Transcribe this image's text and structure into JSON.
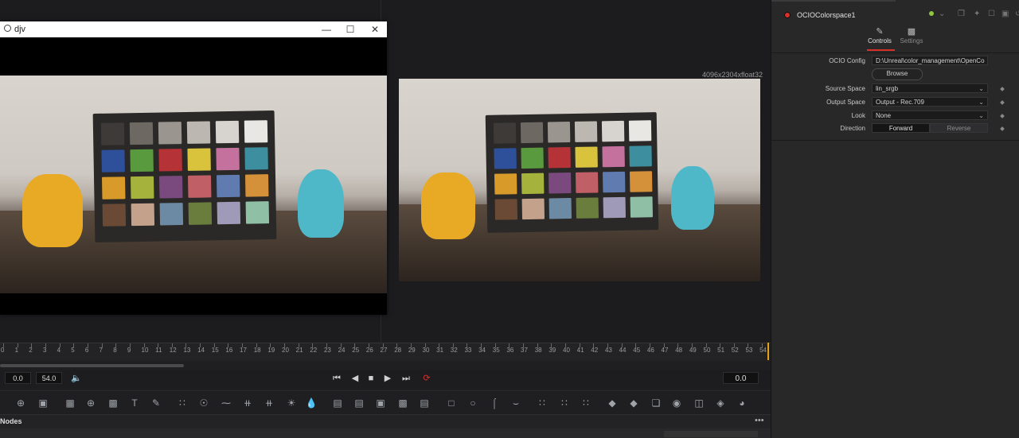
{
  "djv_window": {
    "title": "djv"
  },
  "viewer": {
    "resolution": "4096x2304xfloat32"
  },
  "timeline": {
    "ticks": [
      "0",
      "1",
      "2",
      "3",
      "4",
      "5",
      "6",
      "7",
      "8",
      "9",
      "10",
      "11",
      "12",
      "13",
      "14",
      "15",
      "16",
      "17",
      "18",
      "19",
      "20",
      "21",
      "22",
      "23",
      "24",
      "25",
      "26",
      "27",
      "28",
      "29",
      "30",
      "31",
      "32",
      "33",
      "34",
      "35",
      "36",
      "37",
      "38",
      "39",
      "40",
      "41",
      "42",
      "43",
      "44",
      "45",
      "46",
      "47",
      "48",
      "49",
      "50",
      "51",
      "52",
      "53",
      "54"
    ],
    "start": "0.0",
    "end": "54.0",
    "current": "0.0"
  },
  "nodes": {
    "title": "Nodes",
    "menu": "•••"
  },
  "inspector": {
    "title": "OCIOColorspace1",
    "tabs": [
      {
        "label": "Controls"
      },
      {
        "label": "Settings"
      }
    ],
    "ocio_config": {
      "label": "OCIO Config",
      "value": "D:\\Unreal\\color_management\\OpenCo"
    },
    "browse_label": "Browse",
    "source_space": {
      "label": "Source Space",
      "value": "lin_srgb"
    },
    "output_space": {
      "label": "Output Space",
      "value": "Output - Rec.709"
    },
    "look": {
      "label": "Look",
      "value": "None"
    },
    "direction": {
      "label": "Direction",
      "forward": "Forward",
      "reverse": "Reverse"
    }
  },
  "colors": {
    "accent": "#d9302a",
    "playhead": "#e3a21a",
    "status_green": "#8fc63d"
  }
}
